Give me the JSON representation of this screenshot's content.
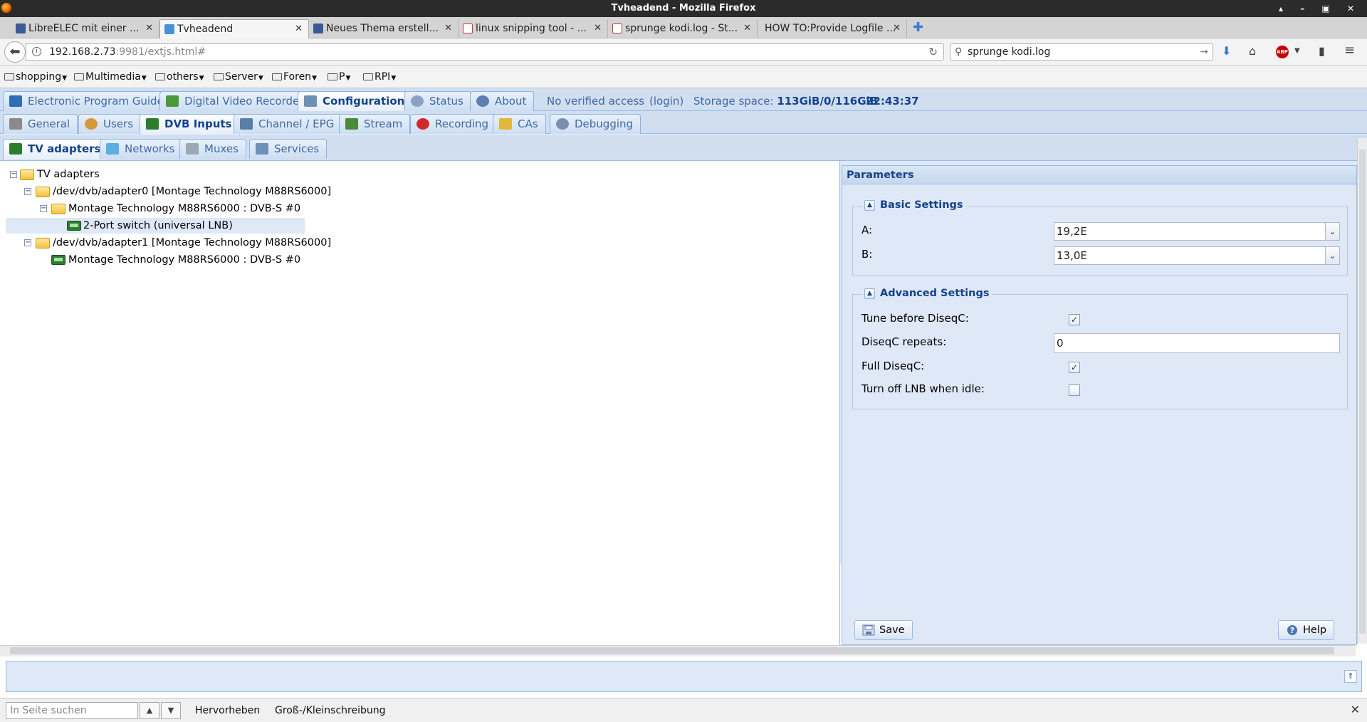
{
  "window": {
    "title": "Tvheadend - Mozilla Firefox",
    "controls": "▴ – ▣ ✕"
  },
  "browser_tabs": [
    {
      "label": "LibreELEC mit einer ...",
      "color": "#3b5998"
    },
    {
      "label": "Tvheadend",
      "color": "#4a90d9"
    },
    {
      "label": "Neues Thema erstell...",
      "color": "#3b5998"
    },
    {
      "label": "linux snipping tool - ...",
      "color": "#c04040"
    },
    {
      "label": "sprunge kodi.log - St...",
      "color": "#c04040"
    },
    {
      "label": "HOW TO:Provide Logfile ...",
      "color": "#ffffff"
    }
  ],
  "navbar": {
    "url_host": "192.168.2.73",
    "url_path": ":9981/extjs.html#",
    "search_value": "sprunge kodi.log"
  },
  "bookmarks": [
    {
      "label": "shopping"
    },
    {
      "label": "Multimedia"
    },
    {
      "label": "others"
    },
    {
      "label": "Server"
    },
    {
      "label": "Foren"
    },
    {
      "label": "P"
    },
    {
      "label": "RPI"
    }
  ],
  "main_tabs": [
    {
      "label": "Electronic Program Guide"
    },
    {
      "label": "Digital Video Recorder"
    },
    {
      "label": "Configuration"
    },
    {
      "label": "Status"
    },
    {
      "label": "About"
    }
  ],
  "header_info": {
    "access": "No verified access",
    "login": "(login)",
    "storage_label": "Storage space:",
    "storage_value": "113GiB/0/116GiB",
    "time": "22:43:37"
  },
  "config_tabs": [
    {
      "label": "General"
    },
    {
      "label": "Users"
    },
    {
      "label": "DVB Inputs"
    },
    {
      "label": "Channel / EPG"
    },
    {
      "label": "Stream"
    },
    {
      "label": "Recording"
    },
    {
      "label": "CAs"
    },
    {
      "label": "Debugging"
    }
  ],
  "dvb_tabs": [
    {
      "label": "TV adapters"
    },
    {
      "label": "Networks"
    },
    {
      "label": "Muxes"
    },
    {
      "label": "Services"
    }
  ],
  "tree": [
    {
      "label": "TV adapters"
    },
    {
      "label": "/dev/dvb/adapter0 [Montage Technology M88RS6000]"
    },
    {
      "label": "Montage Technology M88RS6000 : DVB-S #0"
    },
    {
      "label": "2-Port switch (universal LNB)"
    },
    {
      "label": "/dev/dvb/adapter1 [Montage Technology M88RS6000]"
    },
    {
      "label": "Montage Technology M88RS6000 : DVB-S #0"
    }
  ],
  "params": {
    "title": "Parameters",
    "basic": {
      "legend": "Basic Settings",
      "a_label": "A:",
      "a_value": "19,2E",
      "b_label": "B:",
      "b_value": "13,0E"
    },
    "advanced": {
      "legend": "Advanced Settings",
      "tune_label": "Tune before DiseqC:",
      "tune_checked": true,
      "repeats_label": "DiseqC repeats:",
      "repeats_value": "0",
      "full_label": "Full DiseqC:",
      "full_checked": true,
      "lnb_label": "Turn off LNB when idle:",
      "lnb_checked": false
    },
    "save_label": "Save",
    "help_label": "Help"
  },
  "findbar": {
    "placeholder": "In Seite suchen",
    "highlight": "Hervorheben",
    "match_case": "Groß-/Kleinschreibung"
  },
  "colors": {
    "accent": "#15428b",
    "panel_bg": "#dfe8f6",
    "border": "#99bbe8"
  }
}
